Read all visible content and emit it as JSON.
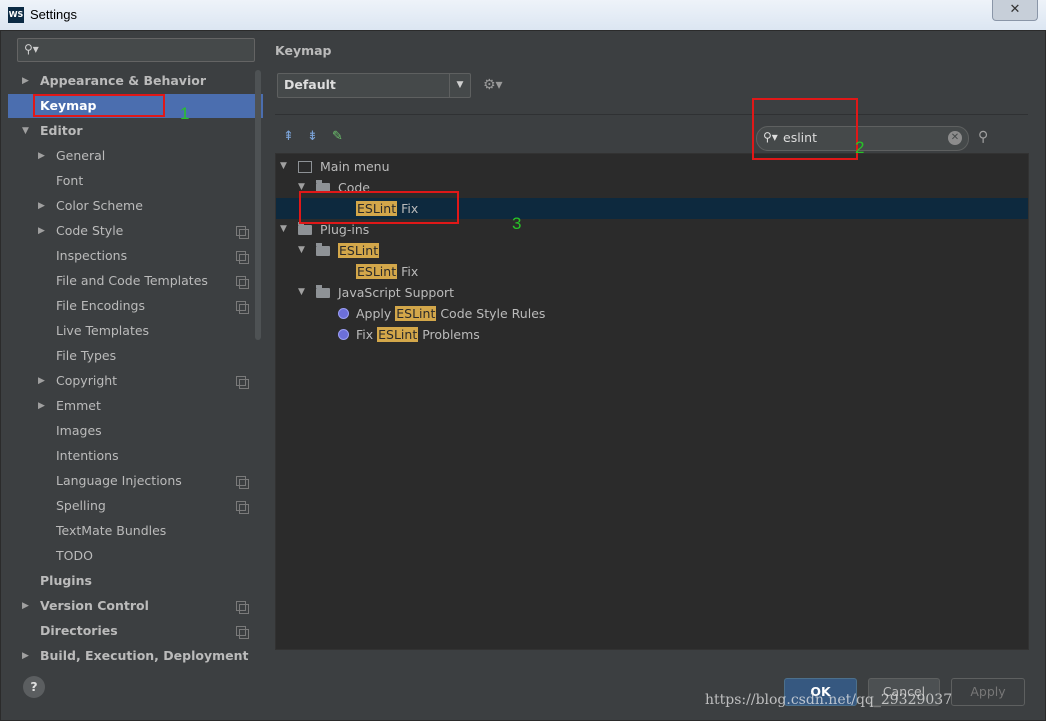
{
  "window": {
    "title": "Settings",
    "app_icon": "WS"
  },
  "sidebar": {
    "search_placeholder": "",
    "items": [
      {
        "label": "Appearance & Behavior",
        "bold": true,
        "arrow": "right",
        "level": 0,
        "project_icon": false
      },
      {
        "label": "Keymap",
        "bold": true,
        "arrow": "",
        "level": 0,
        "selected": true,
        "project_icon": false
      },
      {
        "label": "Editor",
        "bold": true,
        "arrow": "down",
        "level": 0,
        "project_icon": false
      },
      {
        "label": "General",
        "arrow": "right",
        "level": 1,
        "project_icon": false
      },
      {
        "label": "Font",
        "arrow": "",
        "level": 1,
        "project_icon": false
      },
      {
        "label": "Color Scheme",
        "arrow": "right",
        "level": 1,
        "project_icon": false
      },
      {
        "label": "Code Style",
        "arrow": "right",
        "level": 1,
        "project_icon": true
      },
      {
        "label": "Inspections",
        "arrow": "",
        "level": 1,
        "project_icon": true
      },
      {
        "label": "File and Code Templates",
        "arrow": "",
        "level": 1,
        "project_icon": true
      },
      {
        "label": "File Encodings",
        "arrow": "",
        "level": 1,
        "project_icon": true
      },
      {
        "label": "Live Templates",
        "arrow": "",
        "level": 1,
        "project_icon": false
      },
      {
        "label": "File Types",
        "arrow": "",
        "level": 1,
        "project_icon": false
      },
      {
        "label": "Copyright",
        "arrow": "right",
        "level": 1,
        "project_icon": true
      },
      {
        "label": "Emmet",
        "arrow": "right",
        "level": 1,
        "project_icon": false
      },
      {
        "label": "Images",
        "arrow": "",
        "level": 1,
        "project_icon": false
      },
      {
        "label": "Intentions",
        "arrow": "",
        "level": 1,
        "project_icon": false
      },
      {
        "label": "Language Injections",
        "arrow": "",
        "level": 1,
        "project_icon": true
      },
      {
        "label": "Spelling",
        "arrow": "",
        "level": 1,
        "project_icon": true
      },
      {
        "label": "TextMate Bundles",
        "arrow": "",
        "level": 1,
        "project_icon": false
      },
      {
        "label": "TODO",
        "arrow": "",
        "level": 1,
        "project_icon": false
      },
      {
        "label": "Plugins",
        "bold": true,
        "arrow": "",
        "level": 0,
        "project_icon": false
      },
      {
        "label": "Version Control",
        "bold": true,
        "arrow": "right",
        "level": 0,
        "project_icon": true
      },
      {
        "label": "Directories",
        "bold": true,
        "arrow": "",
        "level": 0,
        "project_icon": true
      },
      {
        "label": "Build, Execution, Deployment",
        "bold": true,
        "arrow": "right",
        "level": 0,
        "project_icon": false
      }
    ]
  },
  "keymap": {
    "title": "Keymap",
    "scheme_value": "Default",
    "search_query": "eslint",
    "tree": [
      {
        "parts": [
          {
            "t": "Main menu"
          }
        ],
        "level": 0,
        "kind": "mainmenu",
        "arrow": "down"
      },
      {
        "parts": [
          {
            "t": "Code"
          }
        ],
        "level": 1,
        "kind": "folder",
        "arrow": "down"
      },
      {
        "parts": [
          {
            "t": "ESLint",
            "hl": true
          },
          {
            "t": " Fix"
          }
        ],
        "level": 2,
        "kind": "none",
        "arrow": "",
        "selected": true
      },
      {
        "parts": [
          {
            "t": "Plug-ins"
          }
        ],
        "level": 0,
        "kind": "folder",
        "arrow": "down"
      },
      {
        "parts": [
          {
            "t": "ESLint",
            "hl": true
          }
        ],
        "level": 1,
        "kind": "folder",
        "arrow": "down"
      },
      {
        "parts": [
          {
            "t": "ESLint",
            "hl": true
          },
          {
            "t": " Fix"
          }
        ],
        "level": 2,
        "kind": "none",
        "arrow": ""
      },
      {
        "parts": [
          {
            "t": "JavaScript Support"
          }
        ],
        "level": 1,
        "kind": "folder",
        "arrow": "down"
      },
      {
        "parts": [
          {
            "t": "Apply "
          },
          {
            "t": "ESLint",
            "hl": true
          },
          {
            "t": " Code Style Rules"
          }
        ],
        "level": 2,
        "kind": "action",
        "arrow": ""
      },
      {
        "parts": [
          {
            "t": "Fix "
          },
          {
            "t": "ESLint",
            "hl": true
          },
          {
            "t": " Problems"
          }
        ],
        "level": 2,
        "kind": "action",
        "arrow": ""
      }
    ]
  },
  "annotations": {
    "one": "1",
    "two": "2",
    "three": "3"
  },
  "buttons": {
    "help": "?",
    "ok": "OK",
    "cancel": "Cancel",
    "apply": "Apply"
  },
  "watermark": "https://blog.csdn.net/qq_29329037",
  "colors": {
    "selection": "#4b6eaf",
    "highlight": "#d3a74a",
    "annotation_box": "#e01818",
    "annotation_number": "#27c427"
  }
}
